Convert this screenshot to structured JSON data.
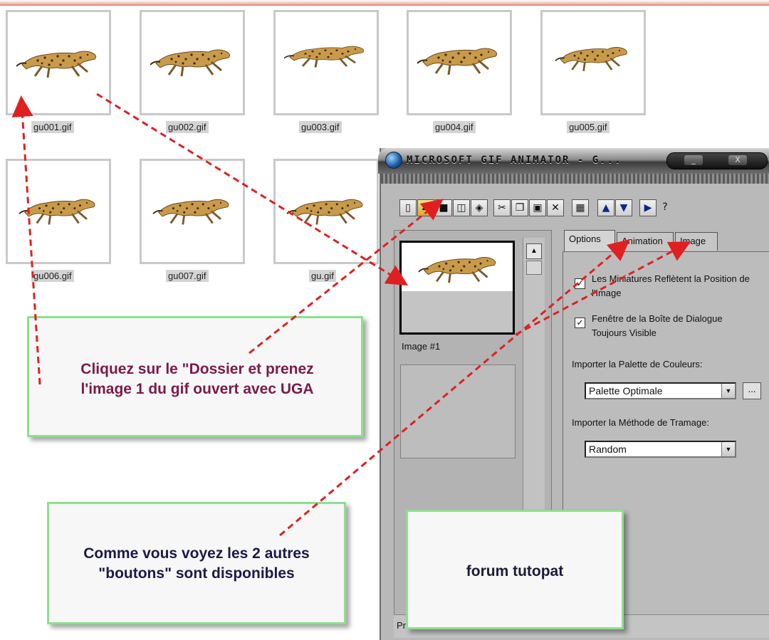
{
  "files": [
    "gu001.gif",
    "gu002.gif",
    "gu003.gif",
    "gu004.gif",
    "gu005.gif",
    "gu006.gif",
    "gu007.gif",
    "gu.gif"
  ],
  "window": {
    "title": "MICROSOFT GIF ANIMATOR - G...",
    "controls": {
      "minimize": "_",
      "close": "X"
    },
    "toolbar": [
      "new-icon",
      "open-folder-icon",
      "save-icon",
      "insert-icon",
      "save-as-icon",
      "cut-icon",
      "copy-icon",
      "paste-icon",
      "delete-icon",
      "select-all-icon",
      "move-up-icon",
      "move-down-icon",
      "play-icon",
      "help-icon"
    ],
    "frame_label": "Image #1",
    "tabs": {
      "options": "Options",
      "animation": "Animation",
      "image": "Image"
    },
    "options": {
      "thumb_reflect": "Les Miniatures Reflètent la Position de l'Image",
      "dialog_visible": "Fenêtre de la Boîte de Dialogue Toujours Visible",
      "palette_label": "Importer la Palette de Couleurs:",
      "palette_value": "Palette Optimale",
      "browse": "...",
      "dither_label": "Importer la Méthode de Tramage:",
      "dither_value": "Random"
    },
    "status": "Pro"
  },
  "notes": {
    "note1_line1": "Cliquez sur le \"Dossier et prenez",
    "note1_line2": "l'image 1 du gif ouvert avec UGA",
    "note2_line1": "Comme vous voyez les 2 autres",
    "note2_line2": "\"boutons\" sont disponibles",
    "note3": "forum tutopat"
  },
  "colors": {
    "arrow": "#e02020",
    "note_border": "#8de08d",
    "note1_text": "#7a1a4a",
    "note2_text": "#1a1a4a"
  }
}
